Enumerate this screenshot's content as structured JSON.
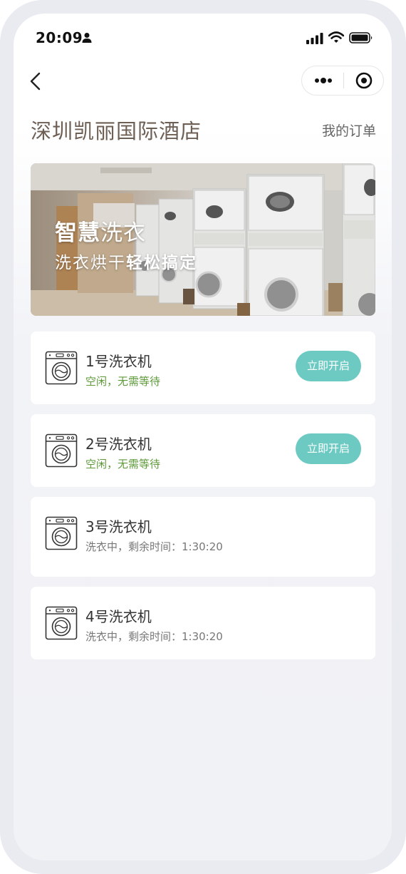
{
  "status_bar": {
    "time": "20:09"
  },
  "nav": {
    "hotel_name": "深圳凯丽国际酒店",
    "orders_link": "我的订单"
  },
  "banner": {
    "title_bold": "智慧",
    "title_rest": "洗衣",
    "subtitle_plain": "洗衣烘干",
    "subtitle_bold": "轻松搞定"
  },
  "machines": [
    {
      "name": "1号洗衣机",
      "status": "空闲，无需等待",
      "state": "idle",
      "button": "立即开启"
    },
    {
      "name": "2号洗衣机",
      "status": "空闲，无需等待",
      "state": "idle",
      "button": "立即开启"
    },
    {
      "name": "3号洗衣机",
      "status": "洗衣中，剩余时间：1:30:20",
      "state": "busy"
    },
    {
      "name": "4号洗衣机",
      "status": "洗衣中，剩余时间：1:30:20",
      "state": "busy"
    }
  ],
  "colors": {
    "accent": "#6ccac3",
    "title_brown": "#6e5f55",
    "idle_green": "#5e9a3a"
  }
}
